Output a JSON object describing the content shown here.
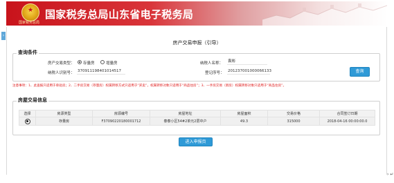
{
  "header": {
    "title": "国家税务总局山东省电子税务局",
    "emblem_text": "国家税务总局",
    "banner_colors": {
      "start": "#c8131b",
      "end": "#ffffff"
    }
  },
  "page": {
    "heading": "房产交易申报（引导）",
    "side_toggle": "›",
    "corner_glyph": "› ↵"
  },
  "query": {
    "legend": "查询条件",
    "trade_type_label": "房产交易类型：",
    "trade_type_options": [
      "存量房",
      "增量房"
    ],
    "trade_type_selected": "存量房",
    "taxpayer_id_label": "纳税人识别号：",
    "taxpayer_id_value": "370911198401014517",
    "taxpayer_name_label": "纳税人名称：",
    "taxpayer_name_value": "袁彬",
    "registration_label": "登记序号：",
    "registration_value": "201237001000066133",
    "search_button": "查询"
  },
  "notice": "注意事项：1、此查报只适用于单处房；2、二手房交易（存量房）权属转移方式只适用于“买卖”，权属转移对象只适用于“商品住房”；3、一手房交易（新房）权属转移对象只适用于“商品住房”。",
  "house_info": {
    "legend": "房屋交易信息",
    "columns": [
      "选择",
      "房源类型",
      "房源编号",
      "房屋地址",
      "房屋面积",
      "交易价格",
      "合同签订日期"
    ],
    "rows": [
      {
        "selected": true,
        "type": "存量房",
        "code": "F3709022018000171​2",
        "address": "泰泰小区54#2单元2层中户",
        "area": "49.3",
        "price": "315000",
        "contract_date": "2018-04-16 00:00:00.0"
      }
    ]
  },
  "actions": {
    "enter_button": "进入申报页"
  }
}
